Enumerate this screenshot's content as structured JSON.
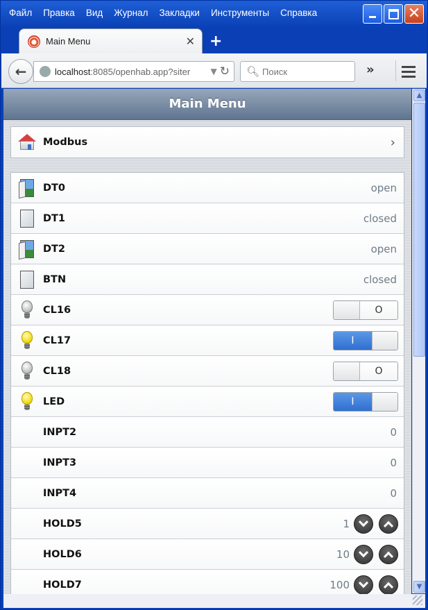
{
  "menubar": {
    "items": [
      "Файл",
      "Правка",
      "Вид",
      "Журнал",
      "Закладки",
      "Инструменты",
      "Справка"
    ]
  },
  "tab": {
    "title": "Main Menu"
  },
  "nav": {
    "url_host": "localhost",
    "url_rest": ":8085/openhab.app?siter",
    "search_placeholder": "Поиск"
  },
  "page": {
    "header": "Main Menu",
    "group": {
      "label": "Modbus"
    },
    "rows": [
      {
        "label": "DT0",
        "value": "open"
      },
      {
        "label": "DT1",
        "value": "closed"
      },
      {
        "label": "DT2",
        "value": "open"
      },
      {
        "label": "BTN",
        "value": "closed"
      },
      {
        "label": "CL16",
        "switch": "O"
      },
      {
        "label": "CL17",
        "switch": "I"
      },
      {
        "label": "CL18",
        "switch": "O"
      },
      {
        "label": "LED",
        "switch": "I"
      },
      {
        "label": "INPT2",
        "value": "0"
      },
      {
        "label": "INPT3",
        "value": "0"
      },
      {
        "label": "INPT4",
        "value": "0"
      },
      {
        "label": "HOLD5",
        "value": "1"
      },
      {
        "label": "HOLD6",
        "value": "10"
      },
      {
        "label": "HOLD7",
        "value": "100"
      }
    ]
  },
  "colors": {
    "switch_on": "#2f6fd0",
    "header_gradient_top": "#97a7ba",
    "value_text": "#6e7c88"
  }
}
